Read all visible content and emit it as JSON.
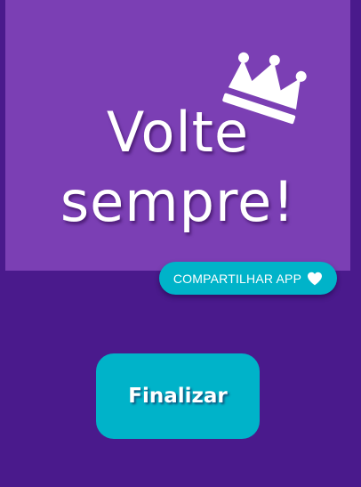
{
  "hero": {
    "title_line1": "Volte",
    "title_line2": "sempre!",
    "crown_icon": "crown-icon"
  },
  "actions": {
    "share_label": "COMPARTILHAR APP",
    "share_icon": "heart-icon",
    "finish_label": "Finalizar"
  },
  "colors": {
    "background": "#4a1a8c",
    "panel": "#7b3fb4",
    "accent": "#00b3c9",
    "text": "#ffffff"
  }
}
